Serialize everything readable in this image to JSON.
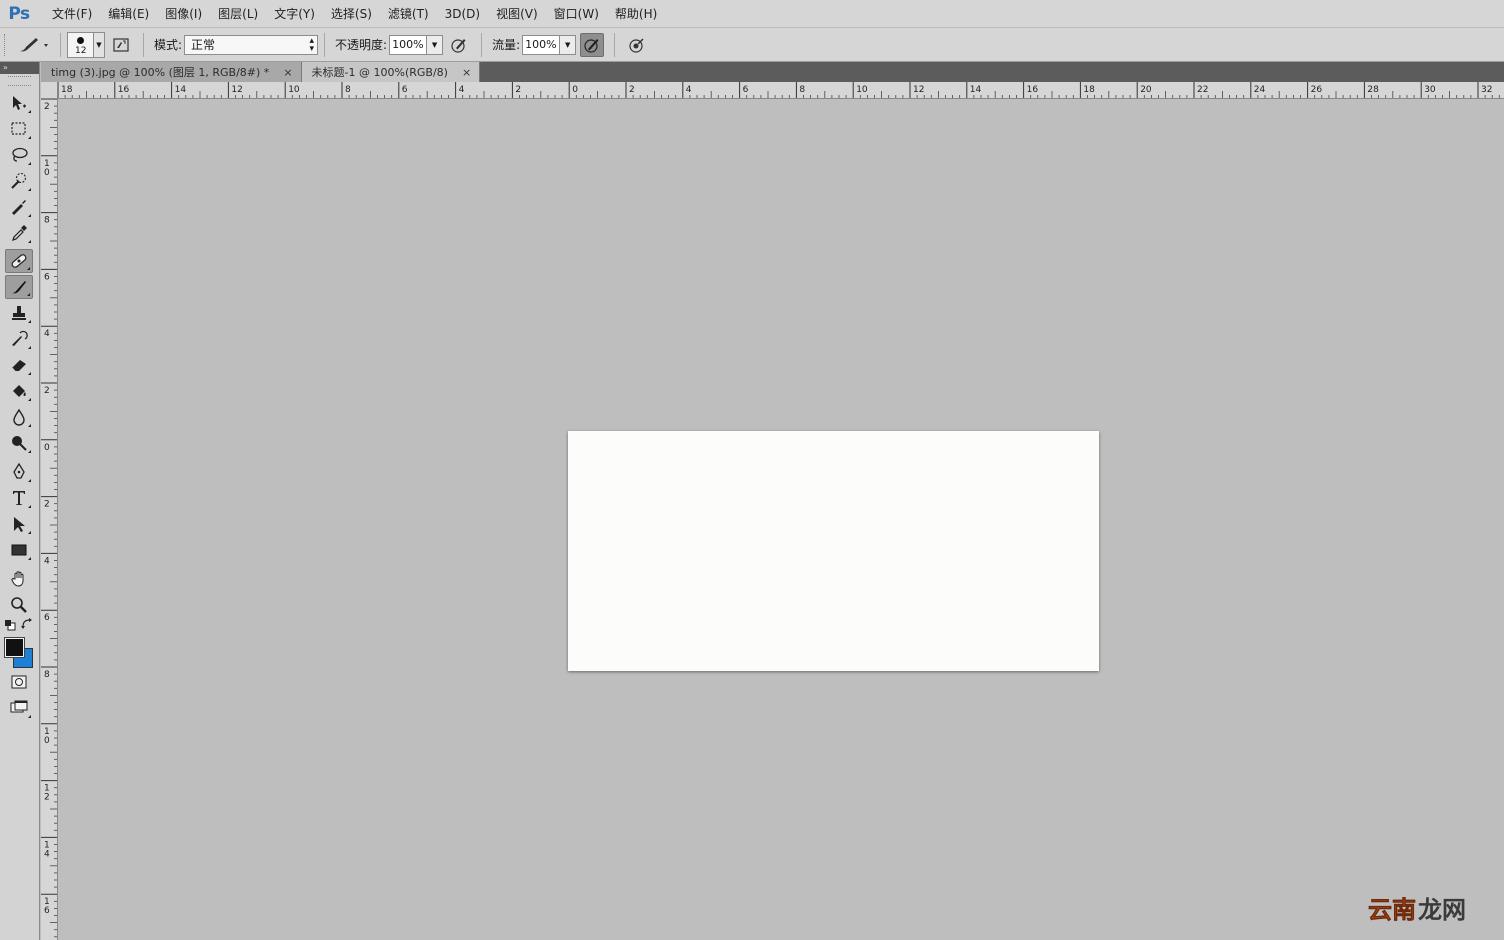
{
  "app": {
    "logo": "Ps"
  },
  "menu": [
    "文件(F)",
    "编辑(E)",
    "图像(I)",
    "图层(L)",
    "文字(Y)",
    "选择(S)",
    "滤镜(T)",
    "3D(D)",
    "视图(V)",
    "窗口(W)",
    "帮助(H)"
  ],
  "options": {
    "brush_size": "12",
    "mode_label": "模式:",
    "mode_value": "正常",
    "opacity_label": "不透明度:",
    "opacity_value": "100%",
    "flow_label": "流量:",
    "flow_value": "100%"
  },
  "toolbox": {
    "collapse": "»"
  },
  "tabs": [
    {
      "title": "timg (3).jpg @ 100% (图层 1, RGB/8#) *",
      "close": "×",
      "active": false
    },
    {
      "title": "未标题-1 @ 100%(RGB/8)",
      "close": "×",
      "active": true
    }
  ],
  "rulers": {
    "horizontal": [
      "18",
      "16",
      "14",
      "12",
      "10",
      "8",
      "6",
      "4",
      "2",
      "0",
      "2",
      "4",
      "6",
      "8",
      "10",
      "12",
      "14",
      "16",
      "18",
      "20",
      "22",
      "24",
      "26",
      "28",
      "30",
      "32"
    ],
    "vertical": [
      "2",
      "10",
      "8",
      "6",
      "4",
      "2",
      "0",
      "2",
      "4",
      "6",
      "8",
      "10",
      "12",
      "14",
      "16"
    ]
  },
  "colors": {
    "foreground": "#111111",
    "background": "#1e7fd6",
    "canvas": "#fcfcfa",
    "workspace": "#bebebe"
  },
  "watermark": {
    "text": "云南龙网"
  }
}
